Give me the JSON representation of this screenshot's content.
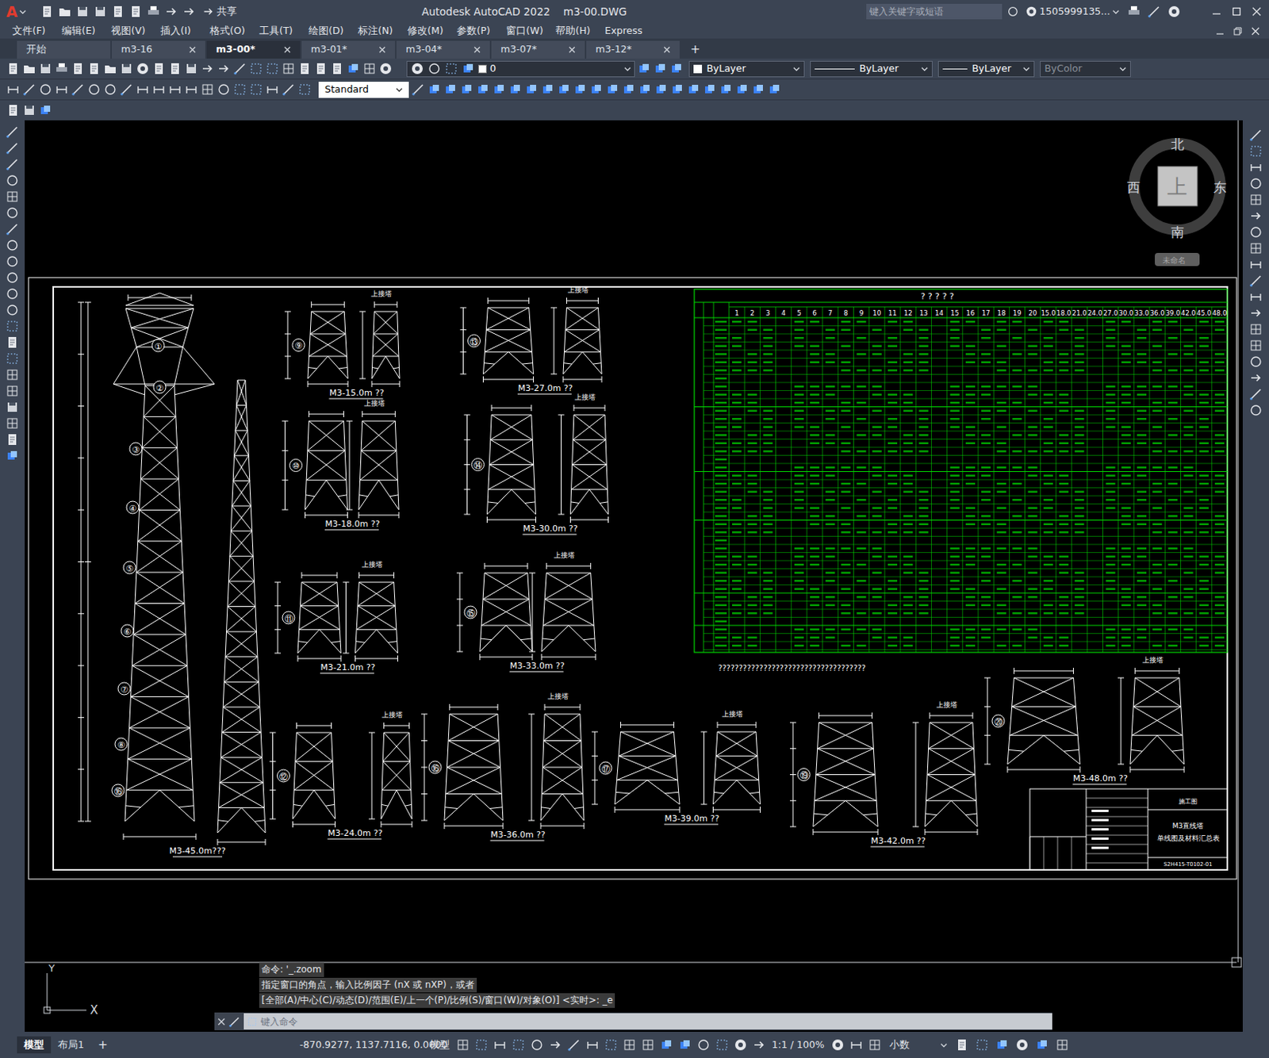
{
  "window": {
    "logo": "A",
    "title": "Autodesk AutoCAD 2022    m3-00.DWG",
    "share": "共享"
  },
  "search": {
    "placeholder": "键入关键字或短语"
  },
  "user": "1505999135...",
  "menu": [
    "文件(F)",
    "编辑(E)",
    "视图(V)",
    "插入(I)",
    "格式(O)",
    "工具(T)",
    "绘图(D)",
    "标注(N)",
    "修改(M)",
    "参数(P)",
    "窗口(W)",
    "帮助(H)",
    "Express"
  ],
  "tabs": [
    {
      "label": "开始",
      "selected": false,
      "closable": false
    },
    {
      "label": "m3-16",
      "selected": false,
      "closable": true
    },
    {
      "label": "m3-00*",
      "selected": true,
      "closable": true
    },
    {
      "label": "m3-01*",
      "selected": false,
      "closable": true
    },
    {
      "label": "m3-04*",
      "selected": false,
      "closable": true
    },
    {
      "label": "m3-07*",
      "selected": false,
      "closable": true
    },
    {
      "label": "m3-12*",
      "selected": false,
      "closable": true
    }
  ],
  "new_tab": "+",
  "toolbar": {
    "layer": "0",
    "color": "ByLayer",
    "linetype": "ByLayer",
    "lineweight": "ByLayer",
    "plotstyle": {
      "label": "ByColor",
      "disabled": true
    },
    "text_style": "Standard"
  },
  "viewcube": {
    "north": "北",
    "south": "南",
    "west": "西",
    "east": "东",
    "face": "上",
    "view": "未命名"
  },
  "main_tower": {
    "label": "M3-45.0m???",
    "marks": [
      "①",
      "②",
      "③",
      "④",
      "⑤",
      "⑥",
      "⑦",
      "⑧",
      "⑯"
    ]
  },
  "sections": [
    {
      "label": "M3-15.0m ??",
      "top": "上接塔",
      "mark": "⑨"
    },
    {
      "label": "M3-27.0m ??",
      "top": "上接塔",
      "mark": "⑬"
    },
    {
      "label": "M3-18.0m ??",
      "top": "上接塔",
      "mark": "⑩"
    },
    {
      "label": "M3-30.0m ??",
      "top": "上接塔",
      "mark": "⑭"
    },
    {
      "label": "M3-21.0m ??",
      "top": "上接塔",
      "mark": "⑪"
    },
    {
      "label": "M3-33.0m ??",
      "top": "上接塔",
      "mark": "⑮"
    },
    {
      "label": "M3-24.0m ??",
      "top": "上接塔",
      "mark": "⑫"
    },
    {
      "label": "M3-36.0m ??",
      "top": "上接塔",
      "mark": "⑯"
    },
    {
      "label": "M3-39.0m ??",
      "top": "上接塔",
      "mark": "⑰"
    },
    {
      "label": "M3-42.0m ??",
      "top": "上接塔",
      "mark": "⑲"
    },
    {
      "label": "M3-48.0m ??",
      "top": "上接塔",
      "mark": "⑳"
    }
  ],
  "table": {
    "title": "? ? ? ? ?",
    "columns": [
      "1",
      "2",
      "3",
      "4",
      "5",
      "6",
      "7",
      "8",
      "9",
      "10",
      "11",
      "12",
      "13",
      "14",
      "15",
      "16",
      "17",
      "18",
      "19",
      "20",
      "15.0",
      "18.0",
      "21.0",
      "24.0",
      "27.0",
      "30.0",
      "33.0",
      "36.0",
      "39.0",
      "42.0",
      "45.0",
      "48.0"
    ],
    "note": "????????????????????????????????????"
  },
  "title_block": {
    "stage": "施工图",
    "name": "M3直线塔",
    "subtitle": "单线图及材料汇总表",
    "number": "S2H415-T0102-01"
  },
  "ucs": {
    "y": "Y",
    "x": "X"
  },
  "command": {
    "history": [
      "命令: '_.zoom",
      "指定窗口的角点，输入比例因子 (nX 或 nXP)，或者",
      "[全部(A)/中心(C)/动态(D)/范围(E)/上一个(P)/比例(S)/窗口(W)/对象(O)] <实时>: _e"
    ],
    "placeholder": "键入命令"
  },
  "layout_tabs": [
    {
      "label": "模型",
      "selected": true
    },
    {
      "label": "布局1",
      "selected": false
    }
  ],
  "add_layout": "+",
  "status": {
    "coords": "-870.9277, 1137.7116, 0.0000",
    "space": "模型",
    "scale": "1:1 / 100%",
    "units": "小数"
  }
}
